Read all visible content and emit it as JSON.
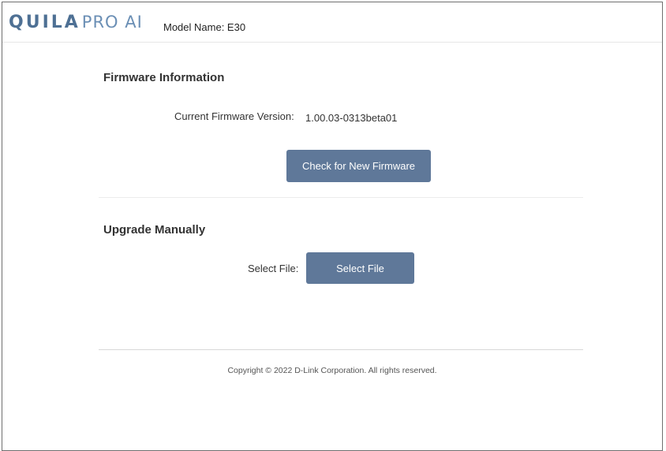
{
  "header": {
    "logo_bold": "QUILA",
    "logo_light": "PRO AI",
    "model_name": "Model Name: E30"
  },
  "firmware_section": {
    "title": "Firmware Information",
    "current_version_label": "Current Firmware Version:",
    "current_version_value": "1.00.03-0313beta01",
    "check_button_label": "Check for New Firmware"
  },
  "manual_section": {
    "title": "Upgrade Manually",
    "select_file_label": "Select File:",
    "select_file_button_label": "Select File"
  },
  "footer": {
    "copyright": "Copyright © 2022 D-Link Corporation. All rights reserved."
  },
  "colors": {
    "button_bg": "#5f7899",
    "logo_primary": "#4e7094",
    "logo_secondary": "#6b8fb5"
  }
}
